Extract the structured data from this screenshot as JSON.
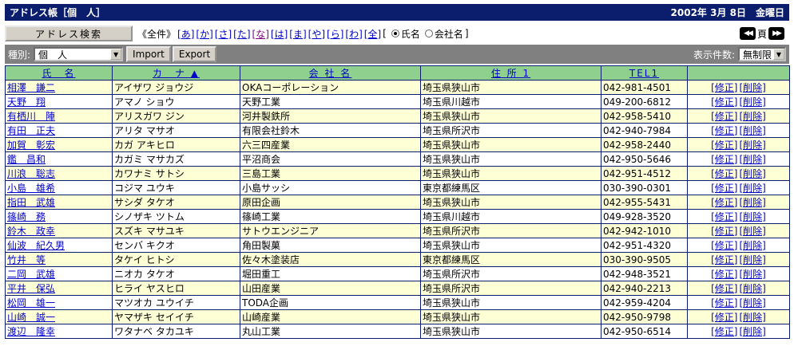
{
  "header": {
    "title": "アドレス帳［個　人］",
    "date": "2002年 3月 8日　金曜日"
  },
  "nav": {
    "search_label": "アドレス検索",
    "all_label": "《全件》",
    "kana_links": [
      "[あ]",
      "[か]",
      "[さ]",
      "[た]",
      "[な]",
      "[は]",
      "[ま]",
      "[や]",
      "[ら]",
      "[わ]",
      "[全]"
    ],
    "bracket_open": "[",
    "radio_name": "氏名",
    "radio_company": "会社名",
    "bracket_close": "]",
    "page_label": "頁"
  },
  "toolbar": {
    "type_label": "種別:",
    "type_value": "個　人",
    "import_label": "Import",
    "export_label": "Export",
    "count_label": "表示件数:",
    "count_value": "無制限"
  },
  "table": {
    "headers": [
      "氏　名",
      "カ　ナ ▲",
      "会 社 名",
      "住 所 1",
      "TEL1",
      ""
    ],
    "edit_label": "[修正]",
    "delete_label": "[削除]",
    "rows": [
      {
        "name": "相澤　謙二",
        "kana": "アイザワ ジョウジ",
        "company": "OKAコーポレーション",
        "address": "埼玉県狭山市",
        "tel": "042-981-4501"
      },
      {
        "name": "天野　翔",
        "kana": "アマノ ショウ",
        "company": "天野工業",
        "address": "埼玉県川越市",
        "tel": "049-200-6812"
      },
      {
        "name": "有栖川　陣",
        "kana": "アリスガワ ジン",
        "company": "河井製鉄所",
        "address": "埼玉県狭山市",
        "tel": "042-958-5410"
      },
      {
        "name": "有田　正夫",
        "kana": "アリタ マサオ",
        "company": "有限会社鈴木",
        "address": "埼玉県所沢市",
        "tel": "042-940-7984"
      },
      {
        "name": "加賀　彰宏",
        "kana": "カガ アキヒロ",
        "company": "六三四産業",
        "address": "埼玉県狭山市",
        "tel": "042-958-2440"
      },
      {
        "name": "鑑　昌和",
        "kana": "カガミ マサカズ",
        "company": "平沼商会",
        "address": "埼玉県狭山市",
        "tel": "042-950-5646"
      },
      {
        "name": "川浪　聡志",
        "kana": "カワナミ サトシ",
        "company": "三島工業",
        "address": "埼玉県狭山市",
        "tel": "042-951-4512"
      },
      {
        "name": "小島　雄希",
        "kana": "コジマ ユウキ",
        "company": "小島サッシ",
        "address": "東京都練馬区",
        "tel": "030-390-0301"
      },
      {
        "name": "指田　武雄",
        "kana": "サシダ タケオ",
        "company": "原田企画",
        "address": "埼玉県狭山市",
        "tel": "042-955-5431"
      },
      {
        "name": "篠崎　務",
        "kana": "シノザキ ツトム",
        "company": "篠崎工業",
        "address": "埼玉県川越市",
        "tel": "049-928-3520"
      },
      {
        "name": "鈴木　政幸",
        "kana": "スズキ マサユキ",
        "company": "サトウエンジニア",
        "address": "埼玉県所沢市",
        "tel": "042-942-1010"
      },
      {
        "name": "仙波　紀久男",
        "kana": "センバ キクオ",
        "company": "角田製菓",
        "address": "埼玉県狭山市",
        "tel": "042-951-4320"
      },
      {
        "name": "竹井　等",
        "kana": "タケイ ヒトシ",
        "company": "佐々木塗装店",
        "address": "東京都練馬区",
        "tel": "030-390-9505"
      },
      {
        "name": "二岡　武雄",
        "kana": "ニオカ タケオ",
        "company": "堀田重工",
        "address": "埼玉県所沢市",
        "tel": "042-948-3521"
      },
      {
        "name": "平井　保弘",
        "kana": "ヒライ ヤスヒロ",
        "company": "山田産業",
        "address": "埼玉県所沢市",
        "tel": "042-940-2213"
      },
      {
        "name": "松岡　雄一",
        "kana": "マツオカ ユウイチ",
        "company": "TODA企画",
        "address": "埼玉県狭山市",
        "tel": "042-959-4204"
      },
      {
        "name": "山崎　誠一",
        "kana": "ヤマザキ セイイチ",
        "company": "山崎産業",
        "address": "埼玉県狭山市",
        "tel": "042-950-9798"
      },
      {
        "name": "渡辺　隆幸",
        "kana": "ワタナベ タカユキ",
        "company": "丸山工業",
        "address": "埼玉県狭山市",
        "tel": "042-950-6514"
      }
    ]
  }
}
